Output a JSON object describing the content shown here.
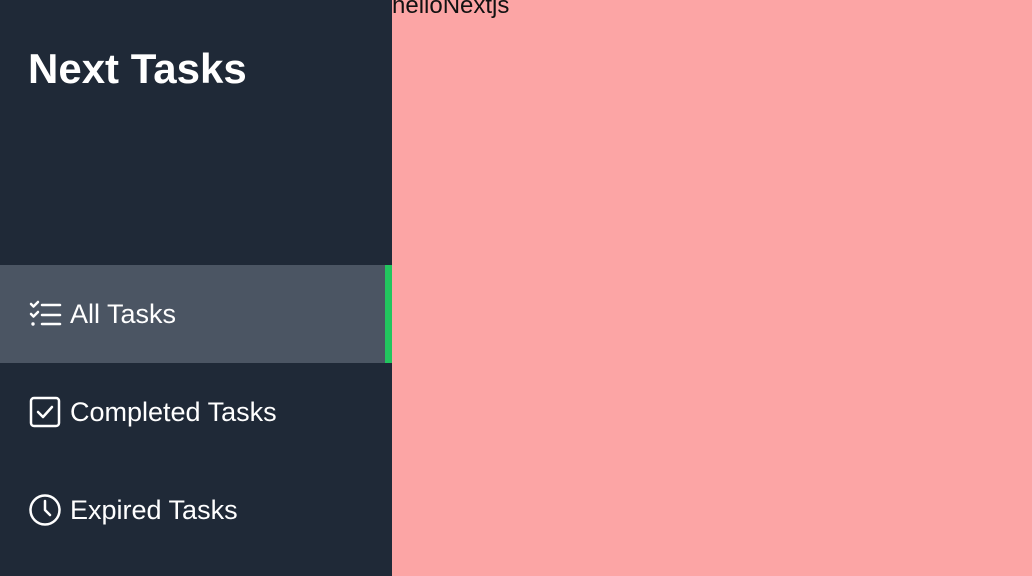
{
  "sidebar": {
    "brand": "Next Tasks",
    "items": [
      {
        "label": "All Tasks",
        "icon": "task-list-icon",
        "active": true
      },
      {
        "label": "Completed Tasks",
        "icon": "checkbox-checked-icon",
        "active": false
      },
      {
        "label": "Expired Tasks",
        "icon": "clock-icon",
        "active": false
      }
    ]
  },
  "main": {
    "text": "helloNextjs"
  },
  "colors": {
    "sidebar_bg": "#1f2937",
    "active_item_bg": "#4b5563",
    "active_indicator": "#22c55e",
    "main_bg": "#fca5a5"
  }
}
